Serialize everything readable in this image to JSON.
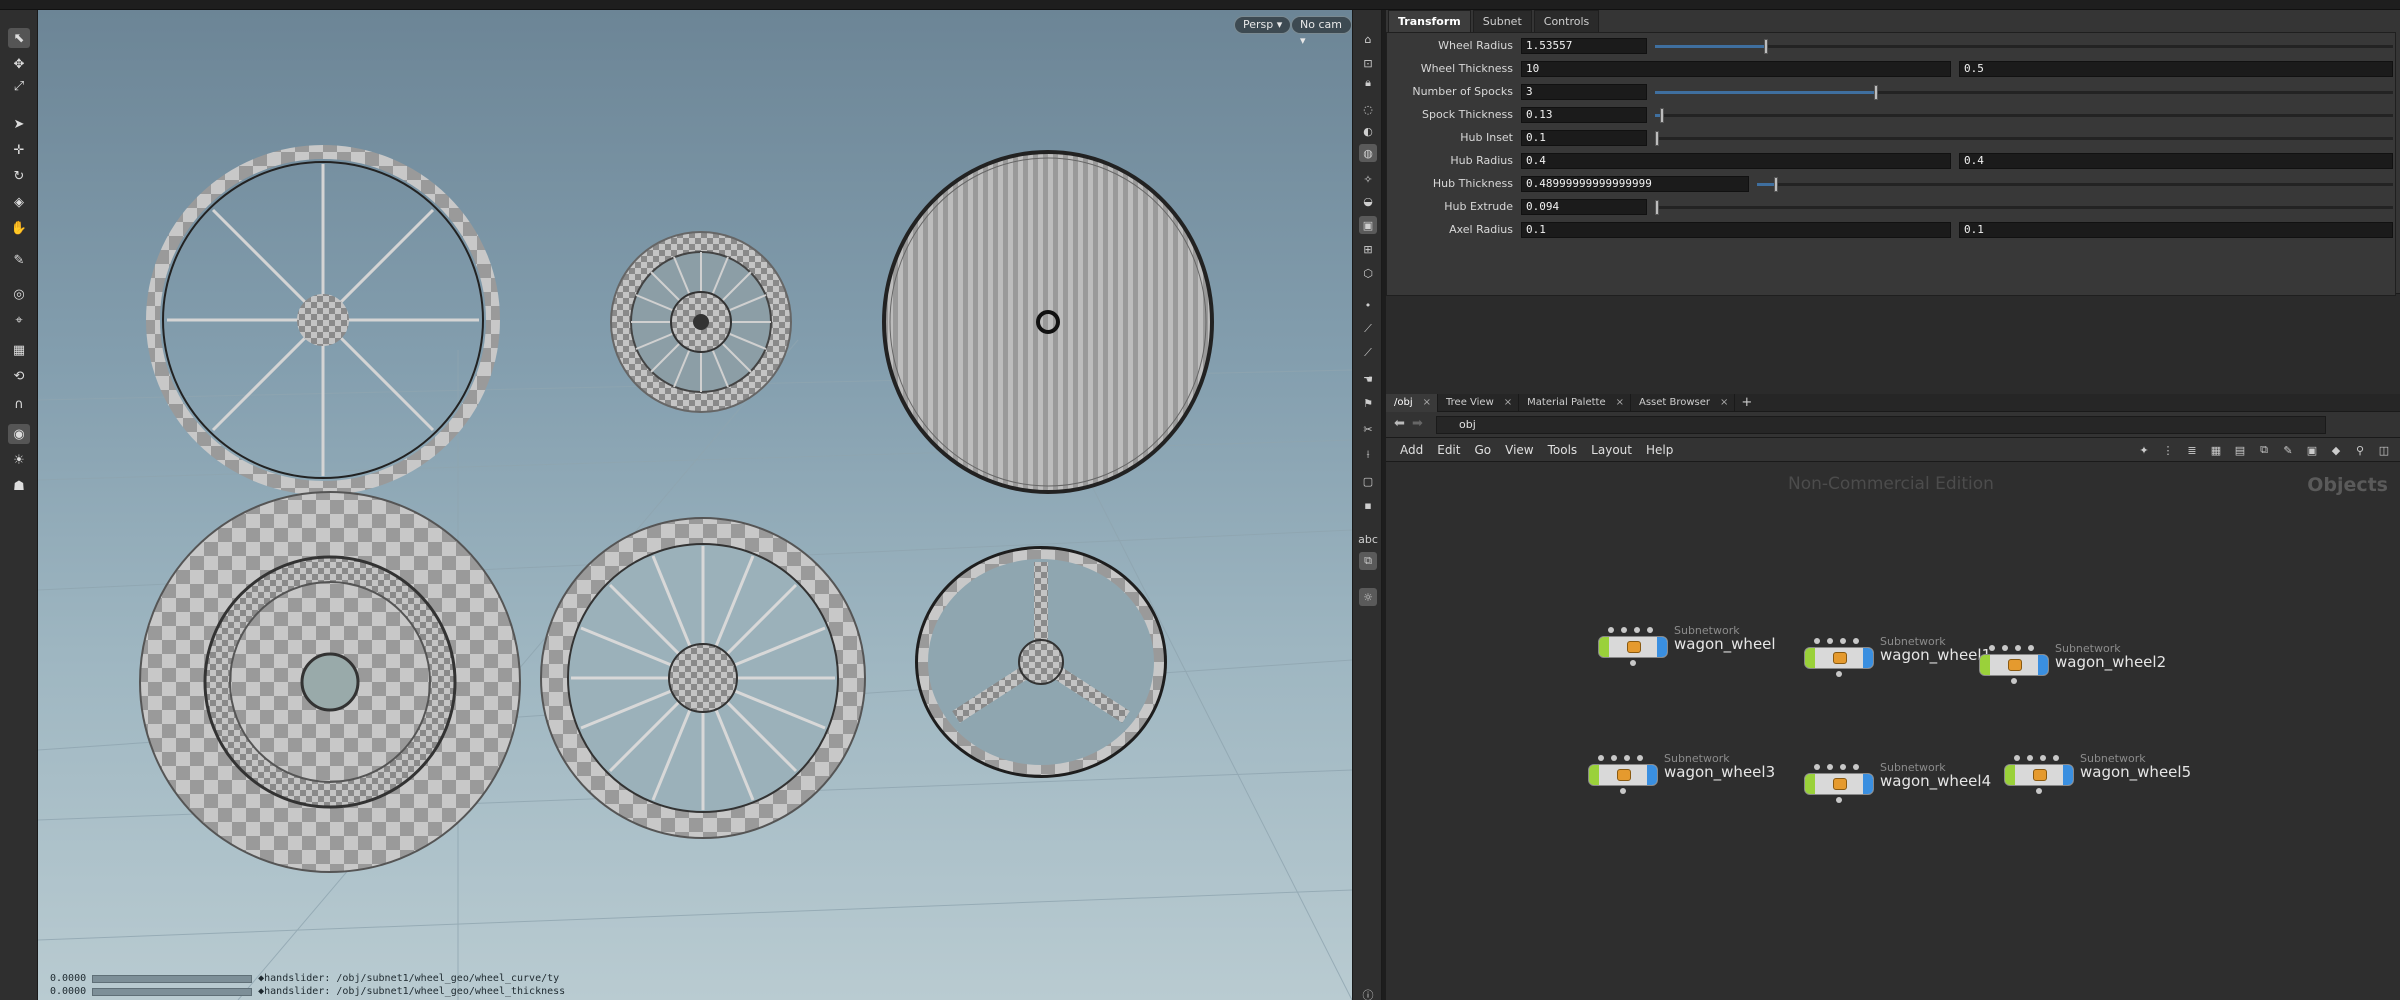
{
  "viewport": {
    "persp_label": "Persp ▾",
    "cam_label": "No cam ▾",
    "hud_value_1": "0.0000",
    "hud_path_1": "◆handslider: /obj/subnet1/wheel_geo/wheel_curve/ty",
    "hud_value_2": "0.0000",
    "hud_path_2": "◆handslider: /obj/subnet1/wheel_geo/wheel_thickness"
  },
  "params": {
    "tabs": [
      {
        "label": "Transform",
        "active": true
      },
      {
        "label": "Subnet",
        "active": false
      },
      {
        "label": "Controls",
        "active": false
      }
    ],
    "rows": [
      {
        "label": "Wheel Radius",
        "value": "1.53557",
        "slider": 0.15
      },
      {
        "label": "Wheel Thickness",
        "value": "10",
        "value2": "0.5"
      },
      {
        "label": "Number of Spocks",
        "value": "3",
        "slider": 0.3
      },
      {
        "label": "Spock Thickness",
        "value": "0.13",
        "slider": 0.01
      },
      {
        "label": "Hub Inset",
        "value": "0.1",
        "slider": 0.0
      },
      {
        "label": "Hub Radius",
        "value": "0.4",
        "value2": "0.4"
      },
      {
        "label": "Hub Thickness",
        "value": "0.48999999999999999",
        "slider": 0.03,
        "wide": true
      },
      {
        "label": "Hub Extrude",
        "value": "0.094",
        "slider": 0.0
      },
      {
        "label": "Axel Radius",
        "value": "0.1",
        "value2": "0.1"
      }
    ]
  },
  "network": {
    "tabs": [
      {
        "label": "/obj",
        "active": true
      },
      {
        "label": "Tree View",
        "active": false
      },
      {
        "label": "Material Palette",
        "active": false
      },
      {
        "label": "Asset Browser",
        "active": false
      }
    ],
    "tab_close": "×",
    "add_tab": "+",
    "path": "obj",
    "menu": [
      "Add",
      "Edit",
      "Go",
      "View",
      "Tools",
      "Layout",
      "Help"
    ],
    "watermark": "Non-Commercial Edition",
    "context_label": "Objects",
    "node_type": "Subnetwork",
    "nodes": [
      {
        "name": "wagon_wheel"
      },
      {
        "name": "wagon_wheel1"
      },
      {
        "name": "wagon_wheel2"
      },
      {
        "name": "wagon_wheel3"
      },
      {
        "name": "wagon_wheel4"
      },
      {
        "name": "wagon_wheel5"
      }
    ]
  },
  "colors": {
    "accent": "#3f6f9f",
    "node_flag_display": "#9ad13a",
    "node_flag_render": "#3a8fe0"
  },
  "icons": {
    "left_shelf": [
      "select-icon",
      "move-icon",
      "view-icon",
      "pose-icon",
      "handle-icon",
      "snap-icon",
      "magnet-icon",
      "camera-icon",
      "light-icon"
    ],
    "right_shelf": [
      "home-icon",
      "wireframe-icon",
      "lock-icon",
      "shading-icon",
      "display-icon",
      "grid-icon",
      "ghost-icon",
      "point-icon",
      "normal-icon"
    ]
  }
}
